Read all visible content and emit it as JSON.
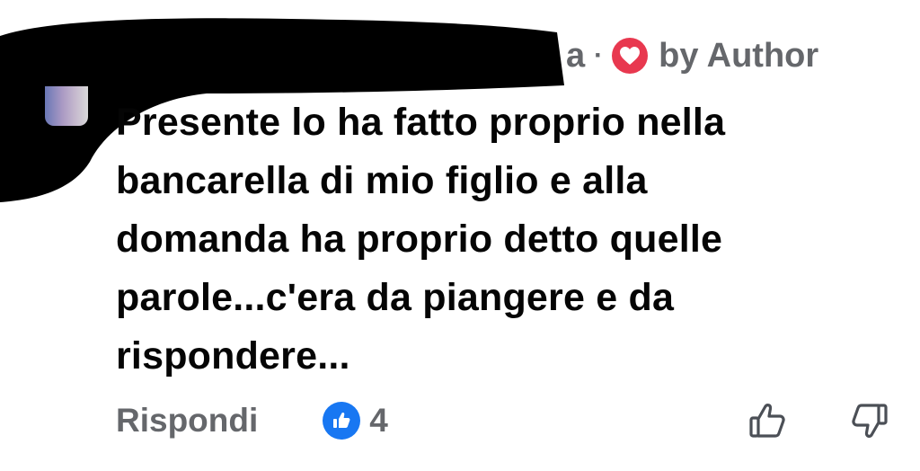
{
  "header": {
    "name_fragment": "a",
    "separator": "·",
    "badge_icon": "heart-icon",
    "liked_by": "by Author",
    "colors": {
      "heart_badge": "#e8384f",
      "meta_text": "#65676b"
    }
  },
  "comment": {
    "lines": [
      "Presente lo ha fatto proprio nella",
      "bancarella di mio figlio e alla",
      "domanda ha proprio detto quelle",
      "parole...c'era da piangere e da",
      "rispondere..."
    ]
  },
  "actions": {
    "reply_label": "Rispondi",
    "reaction_icon": "like-icon",
    "reaction_count": "4",
    "upvote_icon": "thumbs-up-icon",
    "downvote_icon": "thumbs-down-icon",
    "colors": {
      "like_badge": "#1877f2"
    }
  }
}
